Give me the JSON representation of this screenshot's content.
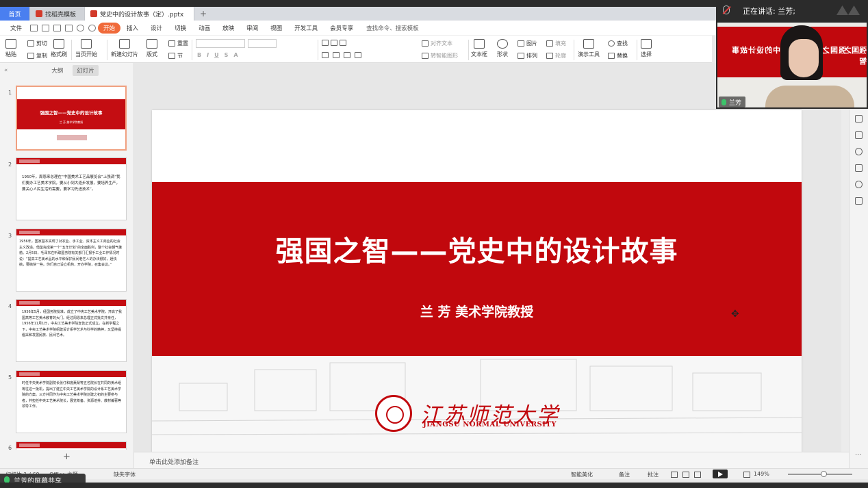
{
  "tabs": {
    "home": "首页",
    "template": "找稻壳模板",
    "document": "党史中的设计故事（定）.pptx",
    "new_tab": "+"
  },
  "menu": {
    "file": "文件",
    "items": [
      "开始",
      "插入",
      "设计",
      "切换",
      "动画",
      "放映",
      "审阅",
      "视图",
      "开发工具",
      "会员专享"
    ],
    "search": "查找命令、搜索模板"
  },
  "ribbon": {
    "paste": "粘贴",
    "cut": "剪切",
    "copy": "复制",
    "format_painter": "格式刷",
    "from_current": "当页开始",
    "new_slide": "新建幻灯片",
    "layout": "版式",
    "section": "节",
    "reset": "重置",
    "align_text": "对齐文本",
    "convert_smartart": "转智能图形",
    "textbox": "文本框",
    "shape": "形状",
    "picture": "图片",
    "fill": "填充",
    "arrange": "排列",
    "outline": "轮廓",
    "present_tools": "演示工具",
    "find": "查找",
    "replace": "替换",
    "select": "选择"
  },
  "left_panel": {
    "tab_outline": "大纲",
    "tab_slides": "幻灯片",
    "thumb1_title": "强国之智——党史中的设计故事",
    "thumb1_sub": "兰 芳  美术学院教授",
    "thumb2_text": "1950年，周恩来总理在“中国美术工艺品展览会”上强调“我们要办工艺美术学院，要从小到大逐步发展，要培养生产，要关心人民生活的需要，要学习先进技术”。",
    "thumb3_text": "1956年，国家基本实现了对农业、手工业、资本主义工商业的社会主义改造。借鉴完成第一个“五年计划”的全面胜利，整个社会朝气蓬勃。2月5日，毛泽东在听取国务院有关部门汇报手工业工作情况时说：“提高工艺美术品的水平和保护民间老艺人的办法很好，赶快搞，要搞快一些。你们自己设立机构，开办学院，召集会议。”",
    "thumb4_text": "1956年5月，经国务院批准，成立了中央工艺美术学院，开启了我国高等工艺美术教育的大门。经过周恩来总理正式批文并亲任，1956年11月1日，中央工艺美术学院宣告正式成立。在新学程之下，中央工艺美术学院组建设计系学艺术与科学的精神，又坚持提倡采和发展民族、民间艺术。",
    "thumb5_text": "时任中央美术学院副院长张仃和庞薰琹等五名院长在共同的美术组筹往这一批机，提出了建立中央工艺美术学院的设计系工艺美术学院的方案。三方共同作为中央工艺美术学院创建之初的主要参与者，并担任中央工艺美术院长，展览筹备、资源培养、教材编著等领导工作。",
    "num1": "1",
    "num2": "2",
    "num3": "3",
    "num4": "4",
    "num5": "5",
    "num6": "6",
    "add": "+"
  },
  "slide": {
    "title": "强国之智——党史中的设计故事",
    "subtitle": "兰 芳  美术学院教授",
    "university_cn": "江苏师范大学",
    "university_en": "JIANGSU NORMAL UNIVERSITY"
  },
  "notes_placeholder": "单击此处添加备注",
  "status": {
    "slide_info": "幻灯片 1 / 69",
    "theme": "Office 主题",
    "missing_font": "缺失字体",
    "smart_beautify": "智能美化",
    "notes": "备注",
    "comments": "批注",
    "zoom": "149%"
  },
  "screen_share": "兰芳的屏幕共享",
  "meeting": {
    "speaking": "正在讲话: 兰芳;",
    "participant": "兰芳",
    "video_text_left": "强国之智——党史中的设计故事",
    "video_text_right": "强国之智"
  },
  "colors": {
    "brand_red": "#c1080d",
    "active_tab": "#f06a3a",
    "home_tab": "#4a7ff0"
  }
}
